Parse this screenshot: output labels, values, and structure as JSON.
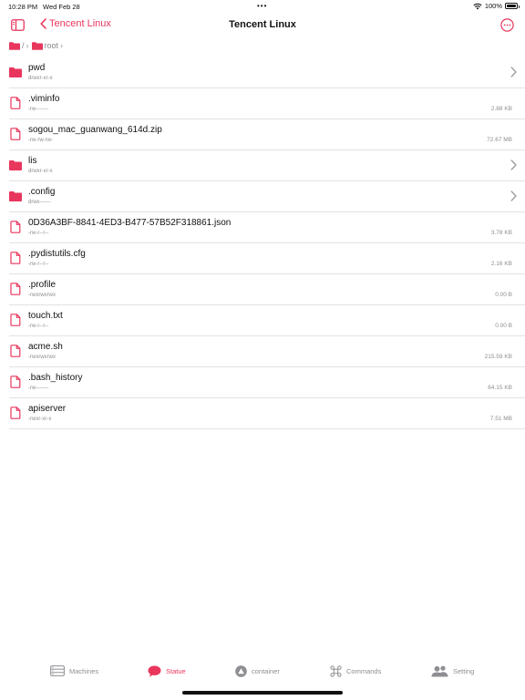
{
  "status_bar": {
    "time": "10:28 PM",
    "date": "Wed Feb 28",
    "dots": "•••",
    "battery": "100%"
  },
  "nav": {
    "back_label": "Tencent Linux",
    "title": "Tencent Linux"
  },
  "breadcrumb": {
    "root_label": "/",
    "folder_label": "root"
  },
  "colors": {
    "accent": "#e8365d",
    "secondary_text": "#8e8e93",
    "separator": "#e2e2e6"
  },
  "files": [
    {
      "name": "pwd",
      "perm": "drwxr-xr-x",
      "size": "",
      "type": "folder"
    },
    {
      "name": ".viminfo",
      "perm": "-rw-------",
      "size": "2.88 KB",
      "type": "file"
    },
    {
      "name": "sogou_mac_guanwang_614d.zip",
      "perm": "-rw-rw-rw-",
      "size": "72.67 MB",
      "type": "file"
    },
    {
      "name": "lis",
      "perm": "drwxr-xr-x",
      "size": "",
      "type": "folder"
    },
    {
      "name": ".config",
      "perm": "drwx------",
      "size": "",
      "type": "folder"
    },
    {
      "name": "0D36A3BF-8841-4ED3-B477-57B52F318861.json",
      "perm": "-rw-r--r--",
      "size": "3.78 KB",
      "type": "file"
    },
    {
      "name": ".pydistutils.cfg",
      "perm": "-rw-r--r--",
      "size": "2.16 KB",
      "type": "file"
    },
    {
      "name": ".profile",
      "perm": "-rwxrwxrwx",
      "size": "0.00 B",
      "type": "file"
    },
    {
      "name": "touch.txt",
      "perm": "-rw-r--r--",
      "size": "0.00 B",
      "type": "file"
    },
    {
      "name": "acme.sh",
      "perm": "-rwxrwxrwx",
      "size": "215.59 KB",
      "type": "file"
    },
    {
      "name": ".bash_history",
      "perm": "-rw-------",
      "size": "64.15 KB",
      "type": "file"
    },
    {
      "name": "apiserver",
      "perm": "-rwxr-xr-x",
      "size": "7.51 MB",
      "type": "file"
    }
  ],
  "tabs": [
    {
      "label": "Machines",
      "icon": "server-icon",
      "active": false
    },
    {
      "label": "Statue",
      "icon": "chat-bubble-icon",
      "active": true
    },
    {
      "label": "container",
      "icon": "warning-triangle-icon",
      "active": false
    },
    {
      "label": "Commands",
      "icon": "command-icon",
      "active": false
    },
    {
      "label": "Setting",
      "icon": "people-icon",
      "active": false
    }
  ]
}
